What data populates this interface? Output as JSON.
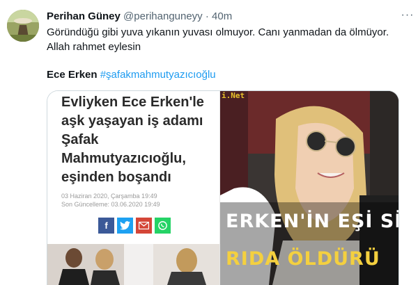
{
  "tweet": {
    "display_name": "Perihan Güney",
    "handle": "@perihanguneyy",
    "separator": "·",
    "time": "40m",
    "more_icon": "more-horizontal-icon",
    "text_line1": "Göründüğü gibi yuva yıkanın yuvası olmuyor. Canı yanmadan da ölmüyor.",
    "text_line2": "Allah rahmet eylesin",
    "mention": "Ece Erken",
    "hashtag": "#şafakmahmutyazıcıoğlu"
  },
  "media": {
    "left": {
      "headline": [
        "Evliyken Ece Erken'le",
        "aşk yaşayan iş adamı",
        "Şafak",
        "Mahmutyazıcıoğlu,",
        "eşinden boşandı"
      ],
      "date": "03 Haziran 2020, Çarşamba 19:49",
      "updated": "Son Güncelleme: 03.06.2020 19:49",
      "share_icons": [
        "facebook-icon",
        "twitter-icon",
        "email-icon",
        "whatsapp-icon"
      ]
    },
    "right": {
      "watermark": "i.Net",
      "banner_line1": "ERKEN'İN EŞİ Sİ",
      "banner_line2": "RIDA ÖLDÜRÜ"
    }
  },
  "colors": {
    "accent": "#1d9bf0",
    "banner_yellow": "#f4d03f",
    "banner_white": "#ffffff"
  }
}
